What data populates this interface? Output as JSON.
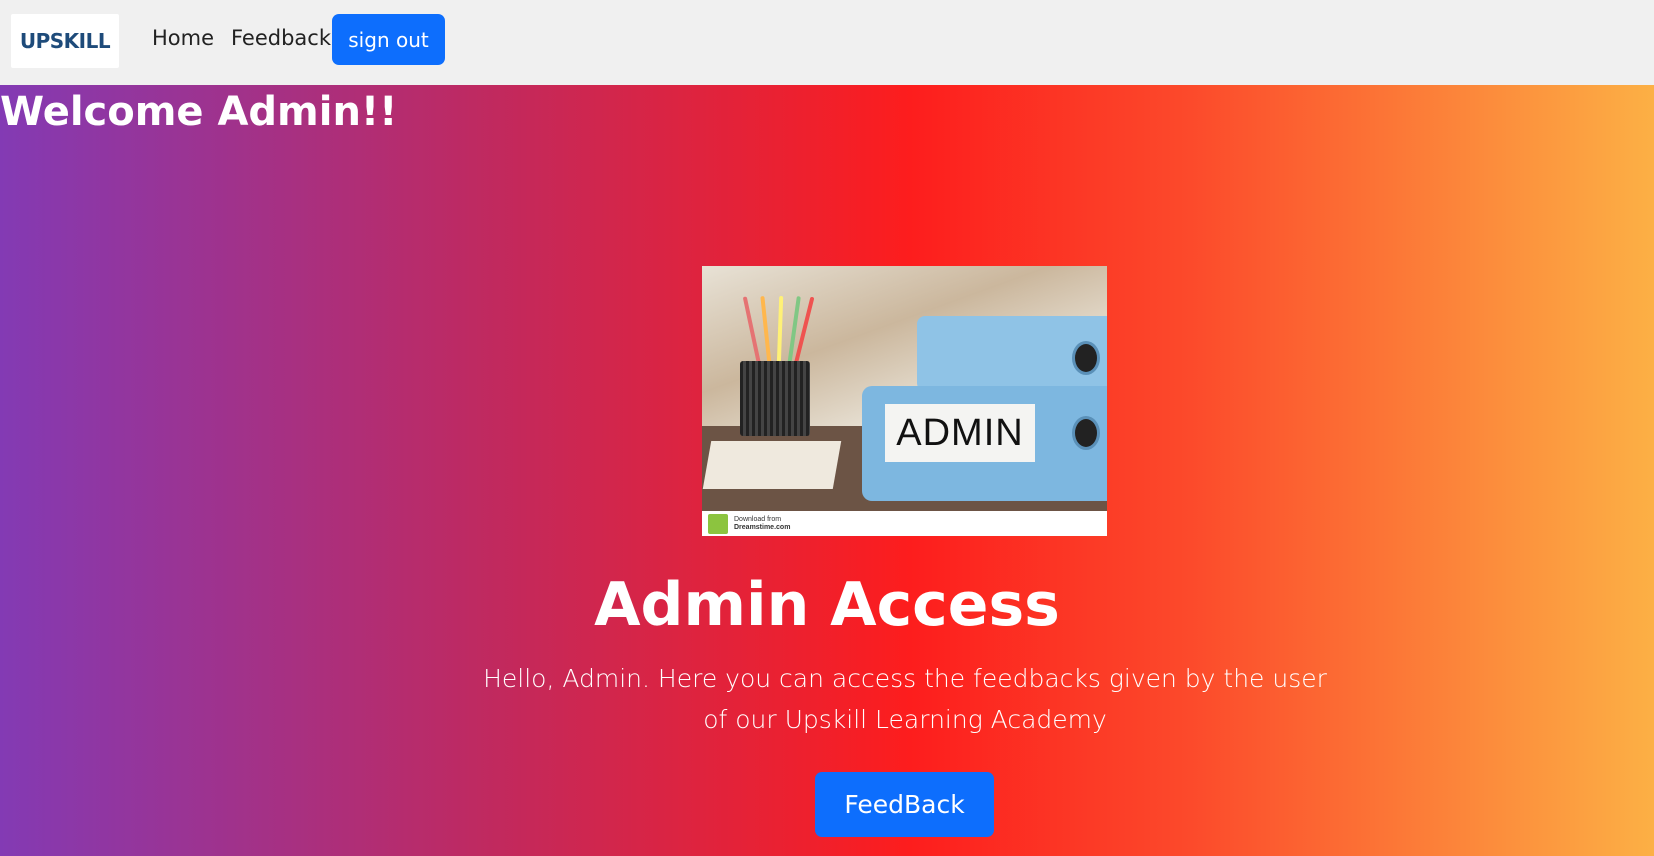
{
  "navbar": {
    "logo_text": "UPSKILL",
    "links": [
      "Home",
      "Feedback"
    ],
    "signout_label": "sign out"
  },
  "hero": {
    "welcome": "Welcome Admin!!",
    "image": {
      "binder_label": "ADMIN",
      "footer_line1": "Download from",
      "footer_line2": "Dreamstime.com"
    },
    "title": "Admin Access",
    "description": "Hello, Admin. Here you can access the feedbacks given by the user of our Upskill Learning Academy",
    "button_label": "FeedBack"
  },
  "colors": {
    "primary_button": "#0d6efd",
    "navbar_bg": "#f0f0f0",
    "gradient": [
      "#833ab4",
      "#fd1d1d",
      "#fcb045"
    ]
  }
}
